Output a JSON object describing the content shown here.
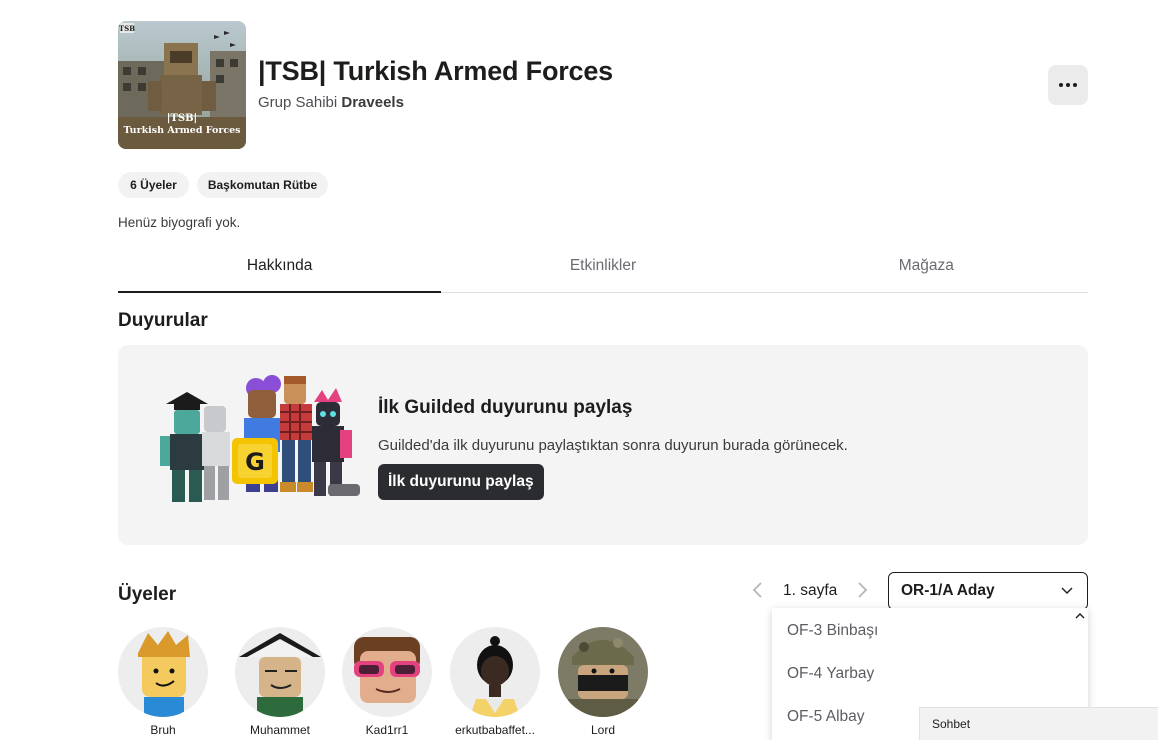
{
  "group": {
    "title": "|TSB| Turkish Armed Forces",
    "owner_prefix": "Grup Sahibi",
    "owner_name": "Draveels",
    "thumb_tag": "TSB",
    "thumb_caption_line1": "|TSB|",
    "thumb_caption_line2": "Turkish Armed Forces",
    "members_pill": "6 Üyeler",
    "rank_pill": "Başkomutan Rütbe",
    "bio": "Henüz biyografi yok."
  },
  "tabs": [
    {
      "label": "Hakkında",
      "active": true
    },
    {
      "label": "Etkinlikler",
      "active": false
    },
    {
      "label": "Mağaza",
      "active": false
    }
  ],
  "announcements": {
    "section_title": "Duyurular",
    "heading": "İlk Guilded duyurunu paylaş",
    "description": "Guilded'da ilk duyurunu paylaştıktan sonra duyurun burada görünecek.",
    "button_label": "İlk duyurunu paylaş",
    "logo_letter": "G"
  },
  "members": {
    "section_title": "Üyeler",
    "page_label": "1. sayfa",
    "rank_selected": "OR-1/A Aday",
    "rank_options": [
      "OF-3 Binbaşı",
      "OF-4 Yarbay",
      "OF-5 Albay"
    ],
    "list": [
      {
        "name": "Bruh"
      },
      {
        "name": "Muhammet"
      },
      {
        "name": "Kad1rr1"
      },
      {
        "name": "erkutbabaffet..."
      },
      {
        "name": "Lord"
      }
    ]
  },
  "chat": {
    "label": "Sohbet"
  },
  "colors": {
    "text_primary": "#1c1d1f",
    "text_secondary": "#6a6c72",
    "surface": "#f4f4f5",
    "button_dark": "#2a2c30"
  }
}
